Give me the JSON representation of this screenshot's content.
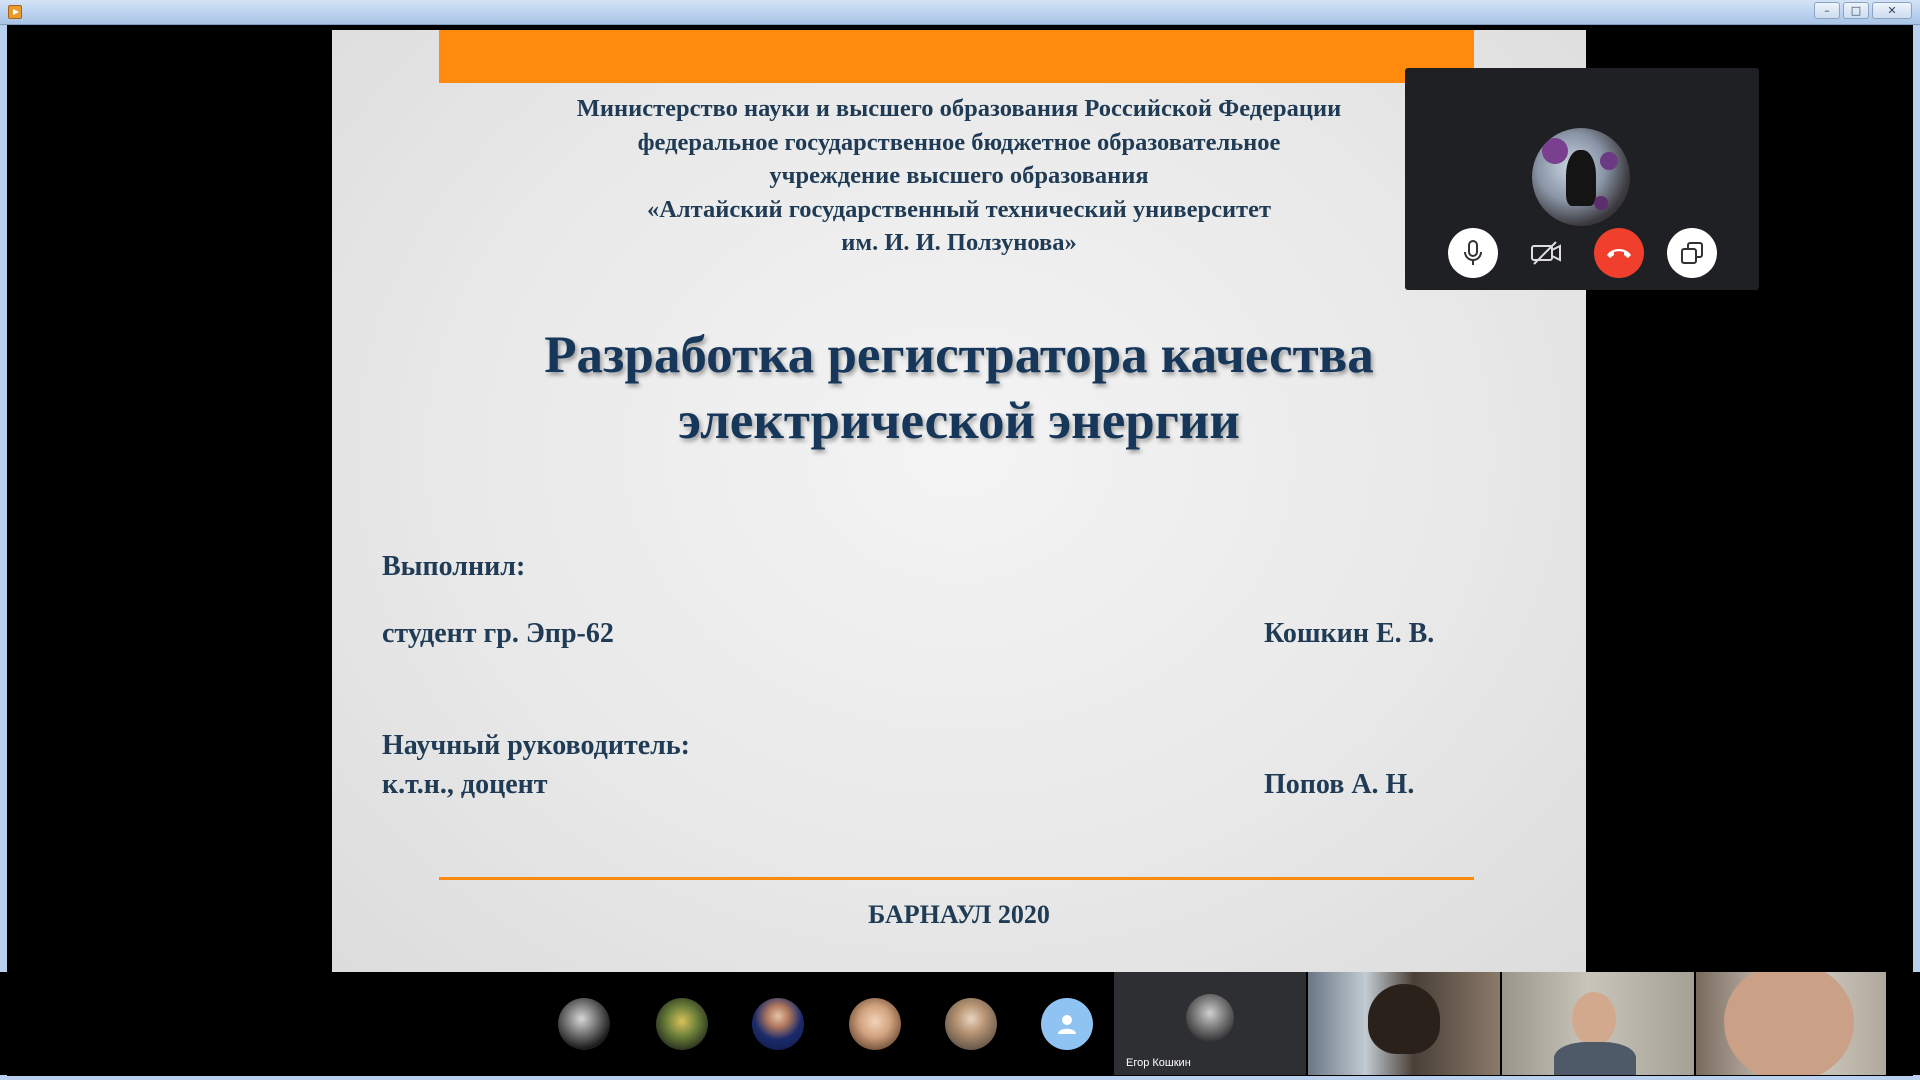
{
  "window": {
    "controls": {
      "minimize": "–",
      "maximize": "□",
      "close": "✕"
    }
  },
  "slide": {
    "ministry_lines": [
      "Министерство науки и высшего образования Российской Федерации",
      "федеральное государственное бюджетное образовательное",
      "учреждение высшего образования",
      "«Алтайский государственный технический университет",
      "им. И. И. Ползунова»"
    ],
    "title_lines": [
      "Разработка регистратора качества",
      "электрической энергии"
    ],
    "performer_heading": "Выполнил:",
    "performer_role": "студент гр. Эпр-62",
    "performer_name": "Кошкин Е. В.",
    "supervisor_heading": "Научный руководитель:",
    "supervisor_role": "к.т.н., доцент",
    "supervisor_name": "Попов А. Н.",
    "city_year": "БАРНАУЛ 2020",
    "accent_color": "#ff8a0d",
    "text_color": "#1f3b55"
  },
  "call_controls": {
    "mic": "microphone-icon",
    "camera": "camera-off-icon",
    "hangup": "hang-up-icon",
    "share": "screen-share-icon",
    "hangup_color": "#f0402d"
  },
  "participants": {
    "video_tile_name": "Егор Кошкин"
  }
}
